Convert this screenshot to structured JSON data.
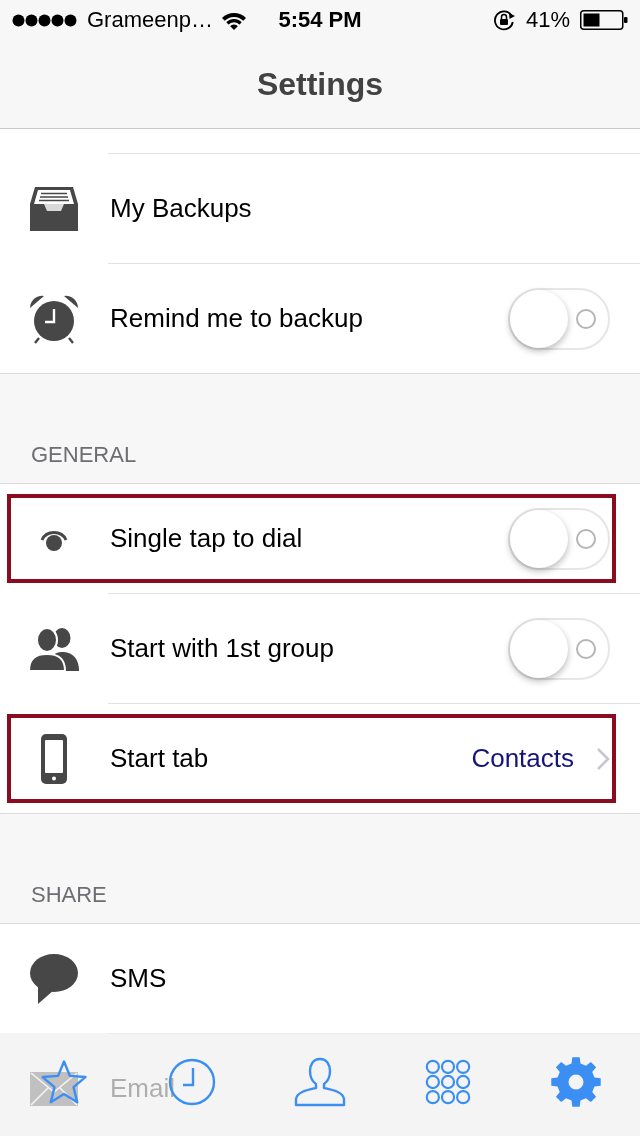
{
  "status_bar": {
    "carrier": "Grameenp…",
    "time": "5:54 PM",
    "battery_percent": "41%"
  },
  "nav_bar": {
    "title": "Settings"
  },
  "sections": [
    {
      "rows": [
        {
          "kind": "plain",
          "label": "My Backups",
          "highlighted": false
        },
        {
          "kind": "toggle",
          "label": "Remind me to backup",
          "on": false,
          "highlighted": false
        }
      ]
    },
    {
      "header": "GENERAL",
      "rows": [
        {
          "kind": "toggle",
          "label": "Single tap to dial",
          "on": false,
          "highlighted": true
        },
        {
          "kind": "toggle",
          "label": "Start with 1st group",
          "on": false,
          "highlighted": false
        },
        {
          "kind": "value",
          "label": "Start tab",
          "value": "Contacts",
          "highlighted": true
        }
      ]
    },
    {
      "header": "SHARE",
      "rows": [
        {
          "kind": "plain",
          "label": "SMS",
          "highlighted": false
        },
        {
          "kind": "plain",
          "label": "Email",
          "highlighted": false
        }
      ]
    }
  ],
  "tab_bar": {
    "tabs": [
      {
        "kind": "star",
        "selected": false
      },
      {
        "kind": "clock",
        "selected": false
      },
      {
        "kind": "person",
        "selected": false
      },
      {
        "kind": "keypad",
        "selected": false
      },
      {
        "kind": "gear",
        "selected": true
      }
    ]
  }
}
